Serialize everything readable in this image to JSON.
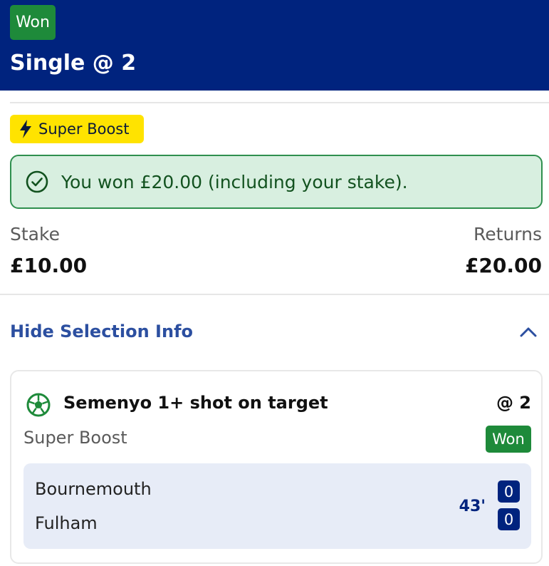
{
  "header": {
    "status_badge": "Won",
    "bet_title": "Single @ 2",
    "background_color": "#00237e"
  },
  "boost": {
    "label": "Super Boost",
    "icon": "lightning-bolt-icon",
    "color": "#ffe300"
  },
  "win_message": {
    "icon": "check-circle-icon",
    "text": "You won £20.00 (including your stake)."
  },
  "stake": {
    "label": "Stake",
    "value": "£10.00"
  },
  "returns": {
    "label": "Returns",
    "value": "£20.00"
  },
  "selection_toggle": {
    "label": "Hide Selection Info",
    "icon": "chevron-up-icon"
  },
  "selection": {
    "icon": "football-icon",
    "name": "Semenyo 1+ shot on target",
    "odds": "@ 2",
    "type": "Super Boost",
    "status_badge": "Won",
    "match": {
      "home_team": "Bournemouth",
      "away_team": "Fulham",
      "time": "43'",
      "home_score": "0",
      "away_score": "0"
    }
  },
  "colors": {
    "won_green": "#1e8a3a",
    "accent_blue": "#2c4fa0"
  }
}
